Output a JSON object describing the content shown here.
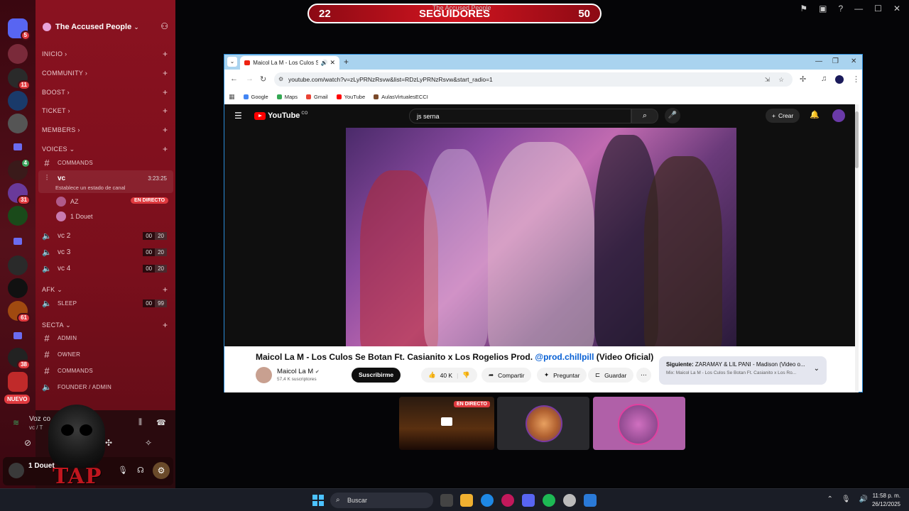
{
  "overlay": {
    "followers_current": "22",
    "followers_label": "SEGUIDORES",
    "followers_goal": "50",
    "followers_subtitle": "The Accused People"
  },
  "discord": {
    "server_name": "The Accused People",
    "rail_badges": [
      "5",
      "11",
      "4",
      "31",
      "61",
      "38"
    ],
    "rail_new_label": "NUEVO",
    "categories": [
      {
        "name": "INICIO"
      },
      {
        "name": "COMMUNITY"
      },
      {
        "name": "BOOST"
      },
      {
        "name": "TICKET"
      },
      {
        "name": "MEMBERS"
      },
      {
        "name": "VOICES"
      },
      {
        "name": "AFK"
      },
      {
        "name": "SECTA"
      }
    ],
    "voices_channels": {
      "commands": "COMMANDS",
      "active_vc": "vc",
      "active_vc_timer": "3:23:25",
      "active_vc_status": "Establece un estado de canal",
      "users": [
        {
          "name": "AZ",
          "live": "EN DIRECTO"
        },
        {
          "name": "1 Douet"
        }
      ],
      "vc2": {
        "name": "vc 2",
        "count": "00",
        "limit": "20"
      },
      "vc3": {
        "name": "vc 3",
        "count": "00",
        "limit": "20"
      },
      "vc4": {
        "name": "vc 4",
        "count": "00",
        "limit": "20"
      }
    },
    "afk_channel": {
      "name": "SLEEP",
      "count": "00",
      "limit": "99"
    },
    "secta_channels": [
      "ADMIN",
      "OWNER",
      "COMMANDS",
      "FOUNDER / ADMIN"
    ],
    "voice_panel": {
      "status": "Voz co",
      "channel": "vc / T"
    },
    "user_panel": {
      "username": "1 Douet",
      "watermark": "TAP"
    }
  },
  "browser": {
    "tab_title": "Maicol La M - Los Culos Se",
    "url": "youtube.com/watch?v=zLyPRNzRsvw&list=RDzLyPRNzRsvw&start_radio=1",
    "bookmarks": [
      {
        "label": "Google",
        "color": "#4285f4"
      },
      {
        "label": "Maps",
        "color": "#34a853"
      },
      {
        "label": "Gmail",
        "color": "#ea4335"
      },
      {
        "label": "YouTube",
        "color": "#ff0000"
      },
      {
        "label": "AulasVirtualesECCI",
        "color": "#7a4a2a"
      }
    ]
  },
  "youtube": {
    "logo_text": "YouTube",
    "logo_country": "CO",
    "search_value": "js serna",
    "create_label": "Crear",
    "video_title": "Maicol La M - Los Culos Se Botan Ft. Casianito x Los Rogelios Prod.",
    "video_title_link": "@prod.chillpill",
    "video_title_suffix": "(Video Oficial)",
    "channel_name": "Maicol La M",
    "subscribers": "57,4 K suscriptores",
    "subscribe_label": "Suscribirme",
    "likes": "40 K",
    "share_label": "Compartir",
    "ask_label": "Preguntar",
    "save_label": "Guardar",
    "next_prefix": "Siguiente:",
    "next_title": "ZARAMAY & LIL PANI - Madison (Video o...",
    "next_mix": "Mix: Maicol La M - Los Culos Se Botan Ft. Casianito x Los Ro..."
  },
  "stream_tiles": {
    "tile1_badge": "EN DIRECTO"
  },
  "taskbar": {
    "search_placeholder": "Buscar",
    "time": "11:58 p. m.",
    "date": "26/12/2025"
  }
}
